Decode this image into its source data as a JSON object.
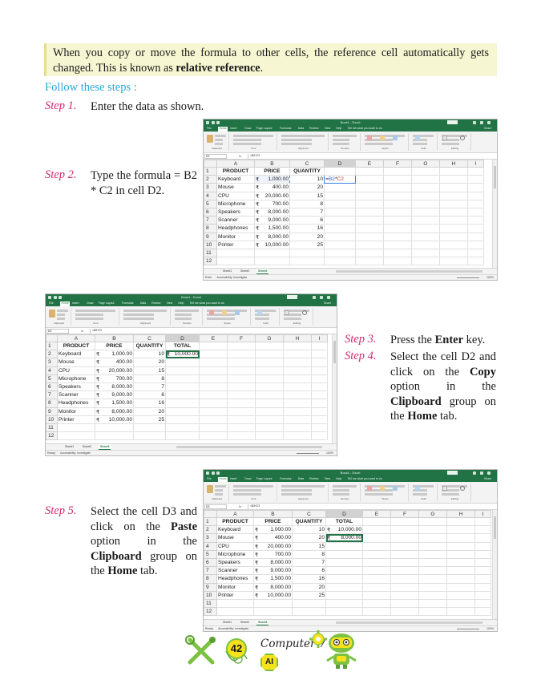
{
  "intro": {
    "text": "When you copy or move the formula to other cells, the reference cell automatically gets changed. This is known as ",
    "bold": "relative reference",
    "end": "."
  },
  "follow": "Follow these steps :",
  "steps": [
    {
      "label": "Step 1.",
      "text": "Enter the data as shown."
    },
    {
      "label": "Step 2.",
      "text": "Type the formula = B2 * C2 in cell D2."
    },
    {
      "label": "Step 3.",
      "pre": "Press the ",
      "bold": "Enter",
      "post": " key."
    },
    {
      "label": "Step 4.",
      "pre": "Select the cell D2 and click on the ",
      "bold1": "Copy",
      "mid": " option in the ",
      "bold2": "Clipboard",
      "mid2": " group on the ",
      "bold3": "Home",
      "post": " tab."
    },
    {
      "label": "Step 5.",
      "pre": "Select the cell D3 and click on the ",
      "bold1": "Paste",
      "mid": " option in the ",
      "bold2": "Clipboard",
      "mid2": " group on the ",
      "bold3": "Home",
      "post": " tab."
    }
  ],
  "excel": {
    "title": "Book1 - Excel",
    "signin": "Sign in",
    "tabs": [
      "File",
      "Home",
      "Insert",
      "Draw",
      "Page Layout",
      "Formulas",
      "Data",
      "Review",
      "View",
      "Help",
      "Tell me what you want to do"
    ],
    "share": "Share",
    "ribbon_groups": [
      "Clipboard",
      "Font",
      "Alignment",
      "Number",
      "Styles",
      "Cells",
      "Editing"
    ],
    "paste": "Paste",
    "font": "Calibri",
    "wrap": "Wrap Text",
    "merge": "Merge & Center",
    "number_format": "Accounting",
    "name_box": [
      "D2",
      "D2",
      "D3"
    ],
    "formula": [
      "=B2*C2",
      "=B2*C2",
      "=B3*C3"
    ],
    "fx": "fx",
    "col_headers": [
      "A",
      "B",
      "C",
      "D",
      "E",
      "F",
      "G",
      "H",
      "I"
    ],
    "row_numbers": [
      "1",
      "2",
      "3",
      "4",
      "5",
      "6",
      "7",
      "8",
      "9",
      "10",
      "11",
      "12"
    ],
    "headers": [
      "PRODUCT",
      "PRICE",
      "QUANTITY",
      "TOTAL"
    ],
    "currency": "₹",
    "rows": [
      {
        "product": "Keyboard",
        "price": "1,000.00",
        "qty": "10"
      },
      {
        "product": "Mouse",
        "price": "400.00",
        "qty": "20"
      },
      {
        "product": "CPU",
        "price": "20,000.00",
        "qty": "15"
      },
      {
        "product": "Microphone",
        "price": "700.00",
        "qty": "8"
      },
      {
        "product": "Speakers",
        "price": "8,000.00",
        "qty": "7"
      },
      {
        "product": "Scanner",
        "price": "9,000.00",
        "qty": "6"
      },
      {
        "product": "Headphones",
        "price": "1,500.00",
        "qty": "16"
      },
      {
        "product": "Monitor",
        "price": "8,000.00",
        "qty": "20"
      },
      {
        "product": "Printer",
        "price": "10,000.00",
        "qty": "25"
      }
    ],
    "edit_formula": {
      "eq": "=",
      "r1": "B2",
      "op": "*",
      "r2": "C2"
    },
    "totals": [
      "10,000.00",
      "8,000.00"
    ],
    "sheets": [
      "Sheet1",
      "Sheet2",
      "Sheet3"
    ],
    "status": [
      "Enter",
      "Ready",
      "Ready"
    ],
    "accessibility": "Accessibility: Investigate",
    "zoom": "100%"
  },
  "footer": {
    "page": "42",
    "book": "Computer-7",
    "badge": "AI"
  }
}
